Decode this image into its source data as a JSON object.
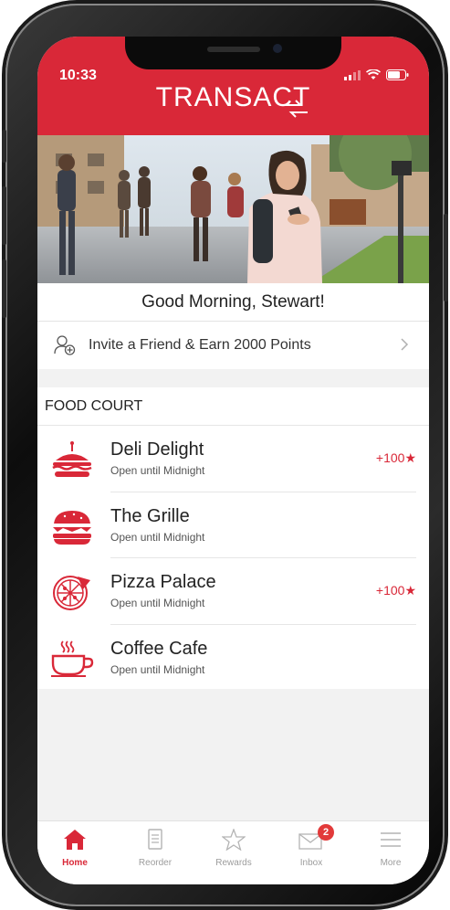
{
  "status_bar": {
    "time": "10:33"
  },
  "header": {
    "logo": "TRANSACT"
  },
  "greeting": "Good Morning, Stewart!",
  "invite": {
    "label": "Invite a Friend & Earn 2000 Points"
  },
  "food_court": {
    "title": "FOOD COURT",
    "items": [
      {
        "name": "Deli Delight",
        "hours": "Open until Midnight",
        "points": "+100",
        "icon": "sandwich-icon"
      },
      {
        "name": "The Grille",
        "hours": "Open until Midnight",
        "points": "",
        "icon": "burger-icon"
      },
      {
        "name": "Pizza Palace",
        "hours": "Open until Midnight",
        "points": "+100",
        "icon": "pizza-icon"
      },
      {
        "name": "Coffee Cafe",
        "hours": "Open until Midnight",
        "points": "",
        "icon": "coffee-icon"
      }
    ]
  },
  "tabs": [
    {
      "label": "Home",
      "icon": "home-icon",
      "active": true
    },
    {
      "label": "Reorder",
      "icon": "reorder-icon"
    },
    {
      "label": "Rewards",
      "icon": "star-icon"
    },
    {
      "label": "Inbox",
      "icon": "mail-icon",
      "badge": "2"
    },
    {
      "label": "More",
      "icon": "menu-icon"
    }
  ],
  "colors": {
    "brand_red": "#d92838",
    "background": "#f2f2f2"
  }
}
